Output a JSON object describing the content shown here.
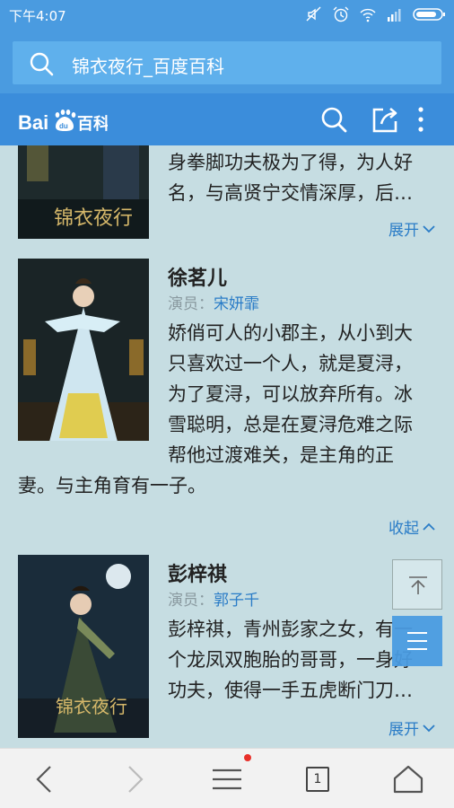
{
  "status_bar": {
    "time": "下午4:07",
    "icons": [
      "mute-icon",
      "alarm-icon",
      "wifi-icon",
      "signal-icon",
      "battery-icon"
    ]
  },
  "address_bar": {
    "title": "锦衣夜行_百度百科",
    "icon": "search-icon"
  },
  "baike_header": {
    "logo_text": "Bai百科",
    "icons": [
      "search-icon",
      "share-icon",
      "more-icon"
    ]
  },
  "characters": [
    {
      "desc_lines": [
        "身拳脚功夫极为了得，为人好",
        "名，与高贤宁交情深厚，后…"
      ],
      "toggle": "展开"
    },
    {
      "name": "徐茗儿",
      "actor_label": "演员：",
      "actor": "宋妍霏",
      "desc_lines": [
        "娇俏可人的小郡主，从小到大",
        "只喜欢过一个人，就是夏浔，",
        "为了夏浔，可以放弃所有。冰",
        "雪聪明，总是在夏浔危难之际",
        "帮他过渡难关，是主角的正"
      ],
      "desc_tail": "妻。与主角育有一子。",
      "toggle": "收起"
    },
    {
      "name": "彭梓祺",
      "actor_label": "演员：",
      "actor": "郭子千",
      "desc_lines": [
        "彭梓祺，青州彭家之女，有一",
        "个龙凤双胞胎的哥哥，一身好",
        "功夫，使得一手五虎断门刀…"
      ],
      "toggle": "展开"
    }
  ],
  "bottom_nav": {
    "tab_count": "1",
    "icons": [
      "back-icon",
      "forward-icon",
      "menu-icon",
      "tabs-icon",
      "home-icon"
    ]
  },
  "colors": {
    "brand_blue": "#3b8ddb",
    "link_blue": "#2a7cc7",
    "page_bg": "#c6dde2"
  }
}
